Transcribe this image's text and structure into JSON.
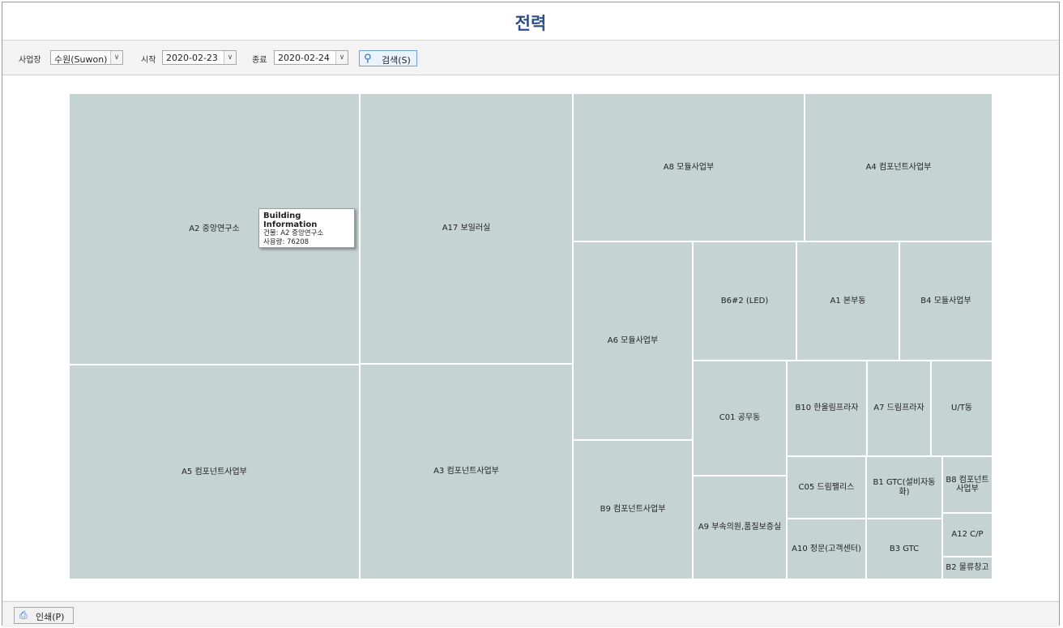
{
  "title": "전력",
  "filters": {
    "site_label": "사업장",
    "site_value": "수원(Suwon)",
    "start_label": "시작",
    "start_value": "2020-02-23",
    "end_label": "종료",
    "end_value": "2020-02-24",
    "search_label": "검색(S)",
    "search_icon": "magnifier-icon"
  },
  "treemap": {
    "fill_color": "#c5d3d3",
    "tiles": [
      {
        "label": "A2 중앙연구소"
      },
      {
        "label": "A5 컴포넌트사업부"
      },
      {
        "label": "A17 보일러실"
      },
      {
        "label": "A3 컴포넌트사업부"
      },
      {
        "label": "A8 모듈사업부"
      },
      {
        "label": "A4 컴포넌트사업부"
      },
      {
        "label": "A6 모듈사업부"
      },
      {
        "label": "B9 컴포넌트사업부"
      },
      {
        "label": "B6#2 (LED)"
      },
      {
        "label": "A1 본부동"
      },
      {
        "label": "B4 모듈사업부"
      },
      {
        "label": "C01 공무동"
      },
      {
        "label": "A9 부속의원,품질보증실"
      },
      {
        "label": "B10 한울림프라자"
      },
      {
        "label": "A7 드림프라자"
      },
      {
        "label": "U/T동"
      },
      {
        "label": "C05 드림팰리스"
      },
      {
        "label": "A10 정문(고객센터)"
      },
      {
        "label": "B1 GTC(설비자동화)"
      },
      {
        "label": "B3 GTC"
      },
      {
        "label": "B8 컴포넌트사업부"
      },
      {
        "label": "A12 C/P"
      },
      {
        "label": "B2 물류창고"
      }
    ]
  },
  "tooltip": {
    "heading": "Building Information",
    "building_line": "건물: A2 중앙연구소",
    "usage_line": "사용량: 76208"
  },
  "footer": {
    "print_label": "인쇄(P)",
    "print_icon": "printer-icon"
  }
}
